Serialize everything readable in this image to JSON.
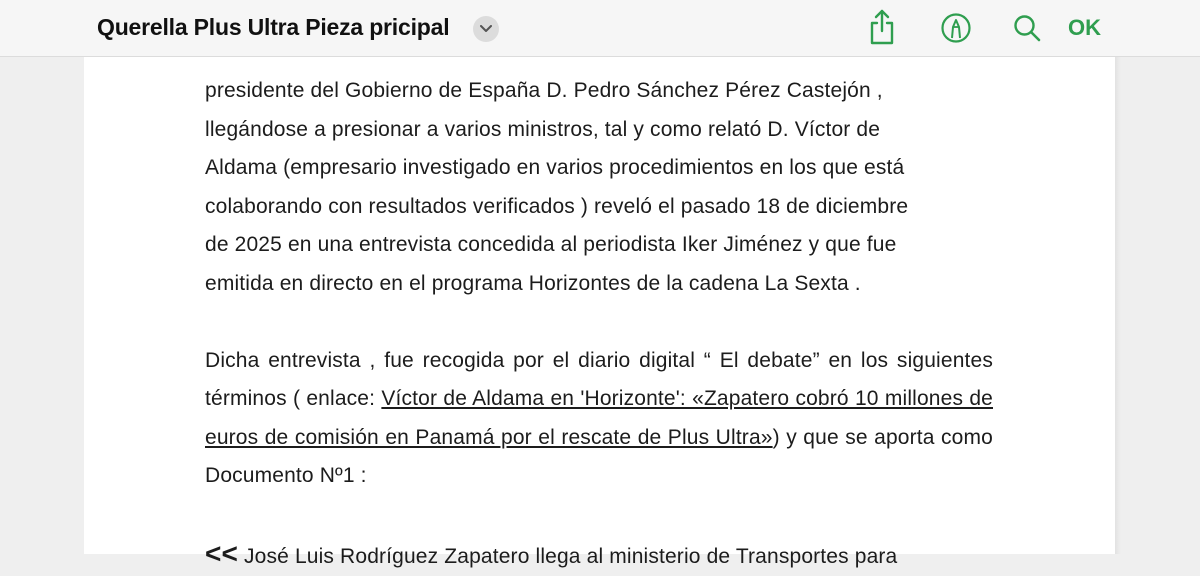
{
  "toolbar": {
    "title": "Querella Plus Ultra Pieza pricipal",
    "ok_label": "OK",
    "icons": [
      "chevron-down-icon",
      "share-icon",
      "markup-icon",
      "search-icon"
    ],
    "accent_color": "#2f9e4f"
  },
  "document": {
    "p1_lines": [
      "presidente del Gobierno de España  D. Pedro Sánchez  Pérez Castejón  ,",
      "llegándose a presionar a varios ministros,  tal y como relató   D. Víctor  de",
      "Aldama (empresario  investigado en varios procedimientos en los que está",
      "colaborando con resultados verificados )  reveló el  pasado 18 de diciembre",
      "de 2025 en una entrevista concedida al periodista Iker Jiménez y que fue",
      "emitida en directo en el programa Horizontes de la cadena  La Sexta ."
    ],
    "p2_intro": "Dicha entrevista , fue recogida por el diario digital “ El debate” en los siguientes términos  ( enlace: ",
    "p2_link": "Víctor de Aldama en 'Horizonte': «Zapatero cobró 10 millones de euros de comisión en Panamá por el rescate de Plus Ultra»",
    "p2_outro": ") y que se aporta como  Documento Nº1  :",
    "p3_quote_mark": "<<",
    "p3_text": " José Luis Rodríguez Zapatero llega al ministerio de Transportes para"
  }
}
